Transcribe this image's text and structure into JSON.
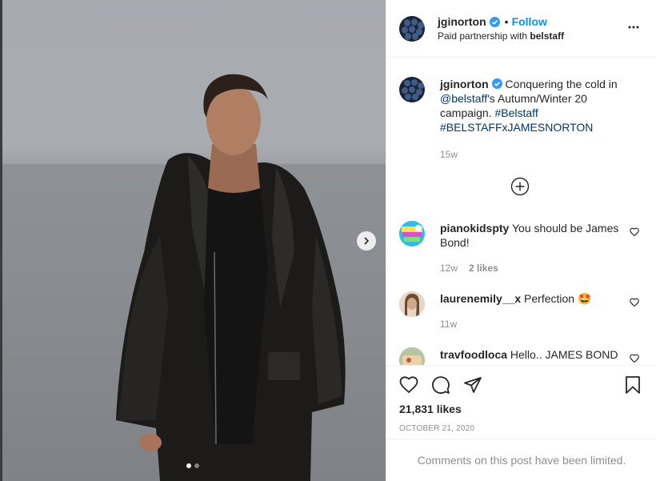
{
  "post": {
    "username": "jginorton",
    "follow_label": "Follow",
    "separator": "•",
    "partnership_prefix": "Paid partnership with ",
    "partner": "belstaff"
  },
  "caption": {
    "username": "jginorton",
    "text_1": " Conquering the cold in ",
    "mention": "@belstaff",
    "text_2": "'s Autumn/Winter 20 campaign. ",
    "hashtag_1": "#Belstaff",
    "hashtag_2": "#BELSTAFFxJAMESNORTON",
    "age": "15w"
  },
  "comments": [
    {
      "username": "pianokidspty",
      "text": " You should be James Bond!",
      "age": "12w",
      "likes": "2 likes"
    },
    {
      "username": "laurenemily__x",
      "text": " Perfection 🤩",
      "age": "11w"
    },
    {
      "username": "travfoodloca",
      "text": " Hello.. JAMES BOND"
    }
  ],
  "engagement": {
    "likes": "21,831 likes",
    "date": "OCTOBER 21, 2020"
  },
  "footer": {
    "limited": "Comments on this post have been limited."
  },
  "carousel": {
    "current": 1,
    "total": 2
  },
  "colors": {
    "link_blue": "#0095f6",
    "verified_blue": "#3897f0",
    "muted": "#8e8e8e",
    "mention": "#00376b"
  },
  "icons": [
    "verified-icon",
    "more-options-icon",
    "chevron-right-icon",
    "add-circle-icon",
    "heart-icon",
    "comment-icon",
    "share-icon",
    "bookmark-icon"
  ]
}
